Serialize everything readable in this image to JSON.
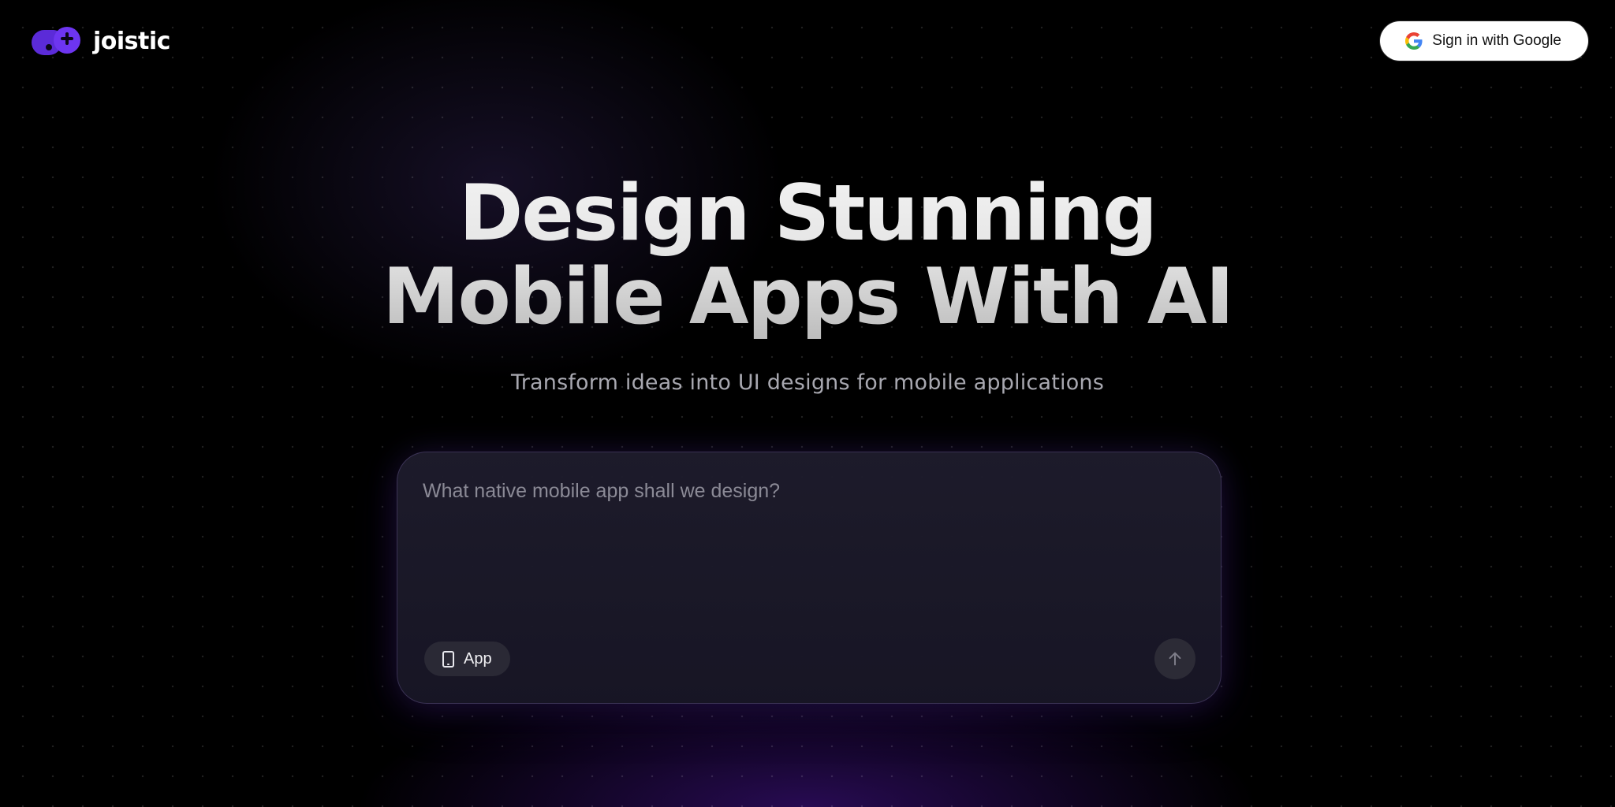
{
  "header": {
    "logo_text": "joistic",
    "signin_label": "Sign in with Google",
    "signin_icon": "google-g-icon"
  },
  "hero": {
    "title_line_1": "Design Stunning",
    "title_line_2": "Mobile Apps With AI",
    "subtitle": "Transform ideas into UI designs for mobile applications"
  },
  "prompt": {
    "placeholder": "What native mobile app shall we design?",
    "value": "",
    "mode_chip_label": "App",
    "mode_chip_icon": "smartphone-icon",
    "send_icon": "arrow-up-icon"
  },
  "colors": {
    "brand_purple": "#6d35f0",
    "background": "#000000",
    "card": "#1c1a2a"
  }
}
